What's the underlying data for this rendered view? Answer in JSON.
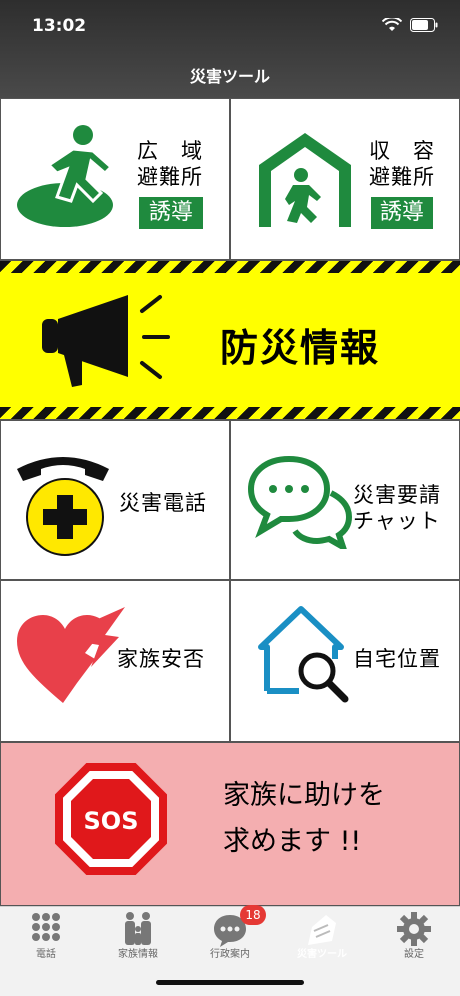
{
  "status": {
    "time": "13:02"
  },
  "header": {
    "title": "災害ツール"
  },
  "tiles": {
    "wide_evac": {
      "line1": "広　域",
      "line2": "避難所",
      "badge": "誘導"
    },
    "shelter": {
      "line1": "収　容",
      "line2": "避難所",
      "badge": "誘導"
    },
    "disaster_info": {
      "label": "防災情報"
    },
    "disaster_phone": {
      "label": "災害電話"
    },
    "rescue_chat": {
      "line1": "災害要請",
      "line2": "チャット"
    },
    "family_safety": {
      "label": "家族安否"
    },
    "home_location": {
      "label": "自宅位置"
    },
    "sos": {
      "icon_text": "SOS",
      "line1": "家族に助けを",
      "line2": "求めます !!"
    }
  },
  "tabbar": {
    "tabs": [
      {
        "label": "電話",
        "icon": "keypad-icon"
      },
      {
        "label": "家族情報",
        "icon": "family-icon"
      },
      {
        "label": "行政案内",
        "icon": "chat-bubble-icon",
        "badge": "18"
      },
      {
        "label": "災害ツール",
        "icon": "collapsed-house-icon",
        "active": true
      },
      {
        "label": "設定",
        "icon": "gear-icon"
      }
    ]
  },
  "colors": {
    "green": "#1f8a3e",
    "yellow": "#ffff00",
    "sos_bg": "#f4aeb0",
    "sos_red": "#e0181b",
    "heart_red": "#e8404a",
    "house_blue": "#1a8fc4"
  }
}
